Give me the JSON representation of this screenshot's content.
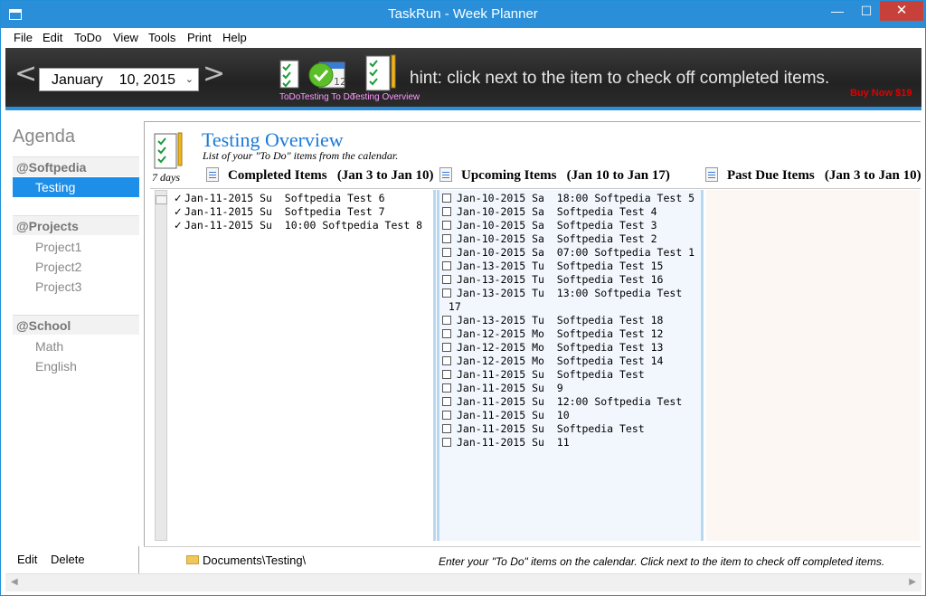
{
  "window": {
    "title": "TaskRun - Week Planner",
    "min_glyph": "—",
    "max_glyph": "☐",
    "close_glyph": "✕"
  },
  "menu": [
    "File",
    "Edit",
    "ToDo",
    "View",
    "Tools",
    "Print",
    "Help"
  ],
  "toolbar": {
    "prev_glyph": "<",
    "next_glyph": ">",
    "date_value": "January    10, 2015",
    "date_chevron": "⌄",
    "labels": {
      "todo": "ToDo",
      "testing_todo": "Testing To Do",
      "testing_overview": "Testing Overview"
    },
    "hint": "hint: click next to the item to check off completed items.",
    "buy_now": "Buy Now $19"
  },
  "sidebar": {
    "title": "Agenda",
    "groups": [
      {
        "name": "@Softpedia",
        "items": [
          "Testing"
        ]
      },
      {
        "name": "@Projects",
        "items": [
          "Project1",
          "Project2",
          "Project3"
        ]
      },
      {
        "name": "@School",
        "items": [
          "Math",
          "English"
        ]
      }
    ],
    "selected": "Testing",
    "edit_label": "Edit",
    "delete_label": "Delete"
  },
  "overview": {
    "days_label": "7 days",
    "title": "Testing Overview",
    "subtitle": "List of your \"To Do\" items from the calendar.",
    "columns": {
      "completed": "Completed Items   (Jan 3 to Jan 10)",
      "upcoming": "Upcoming Items   (Jan 10 to Jan 17)",
      "pastdue": "Past Due Items   (Jan 3 to Jan 10)"
    },
    "completed_items": [
      "Jan-11-2015 Su  Softpedia Test 6",
      "Jan-11-2015 Su  Softpedia Test 7",
      "Jan-11-2015 Su  10:00 Softpedia Test 8"
    ],
    "upcoming_items": [
      "Jan-10-2015 Sa  18:00 Softpedia Test 5",
      "Jan-10-2015 Sa  Softpedia Test 4",
      "Jan-10-2015 Sa  Softpedia Test 3",
      "Jan-10-2015 Sa  Softpedia Test 2",
      "Jan-10-2015 Sa  07:00 Softpedia Test 1",
      "Jan-13-2015 Tu  Softpedia Test 15",
      "Jan-13-2015 Tu  Softpedia Test 16",
      "Jan-13-2015 Tu  13:00 Softpedia Test\n 17",
      "Jan-13-2015 Tu  Softpedia Test 18",
      "Jan-12-2015 Mo  Softpedia Test 12",
      "Jan-12-2015 Mo  Softpedia Test 13",
      "Jan-12-2015 Mo  Softpedia Test 14",
      "Jan-11-2015 Su  Softpedia Test",
      "Jan-11-2015 Su  9",
      "Jan-11-2015 Su  12:00 Softpedia Test",
      "Jan-11-2015 Su  10",
      "Jan-11-2015 Su  Softpedia Test",
      "Jan-11-2015 Su  11"
    ],
    "pastdue_items": []
  },
  "status": {
    "path": "Documents\\Testing\\",
    "hint": "Enter your \"To Do\" items on the calendar. Click next to the item to check off completed items."
  },
  "colors": {
    "accent": "#2a8fd8",
    "selected": "#1e8fe8",
    "title_blue": "#1a7ad8",
    "buy_now": "#e00000"
  }
}
